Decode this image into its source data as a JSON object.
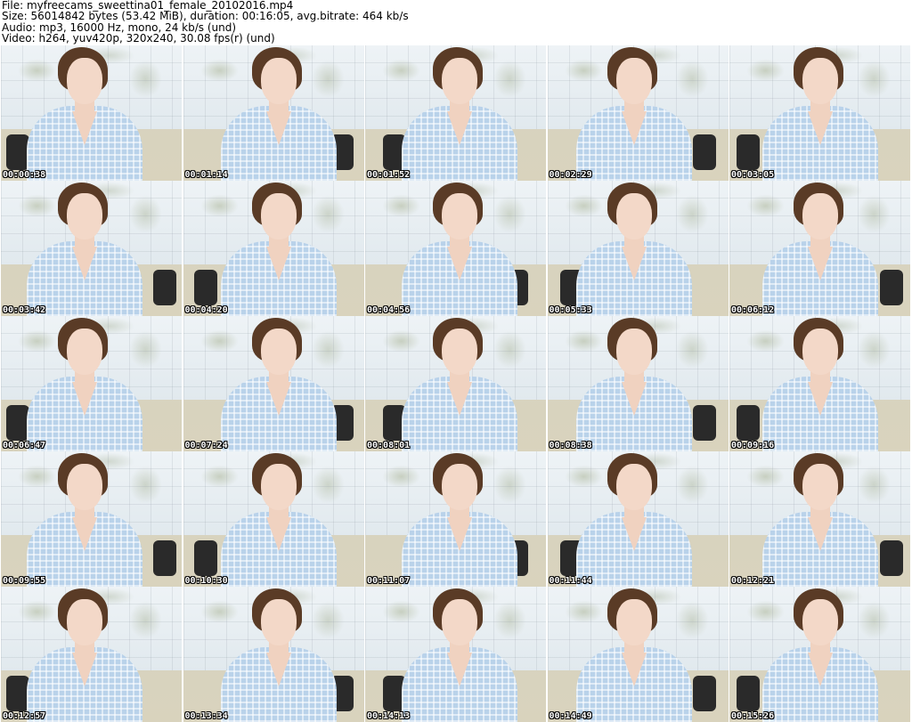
{
  "header": {
    "file": "File: myfreecams_sweettina01_female_20102016.mp4",
    "size": "Size: 56014842 bytes (53.42 MiB), duration: 00:16:05, avg.bitrate: 464 kb/s",
    "audio": "Audio: mp3, 16000 Hz, mono, 24 kb/s (und)",
    "video": "Video: h264, yuv420p, 320x240, 30.08 fps(r) (und)"
  },
  "thumbnails": [
    {
      "time": "00:00:38"
    },
    {
      "time": "00:01:14"
    },
    {
      "time": "00:01:52"
    },
    {
      "time": "00:02:29"
    },
    {
      "time": "00:03:05"
    },
    {
      "time": "00:03:42"
    },
    {
      "time": "00:04:20"
    },
    {
      "time": "00:04:56"
    },
    {
      "time": "00:05:33"
    },
    {
      "time": "00:06:12"
    },
    {
      "time": "00:06:47"
    },
    {
      "time": "00:07:24"
    },
    {
      "time": "00:08:01"
    },
    {
      "time": "00:08:38"
    },
    {
      "time": "00:09:16"
    },
    {
      "time": "00:09:55"
    },
    {
      "time": "00:10:30"
    },
    {
      "time": "00:11:07"
    },
    {
      "time": "00:11:44"
    },
    {
      "time": "00:12:21"
    },
    {
      "time": "00:12:57"
    },
    {
      "time": "00:13:34"
    },
    {
      "time": "00:14:13"
    },
    {
      "time": "00:14:49"
    },
    {
      "time": "00:15:26"
    }
  ],
  "colors": {
    "timestamp_text": "#ffffff",
    "timestamp_outline": "#000000",
    "shirt": "#b9d2ea",
    "hair": "#5a3b26"
  }
}
